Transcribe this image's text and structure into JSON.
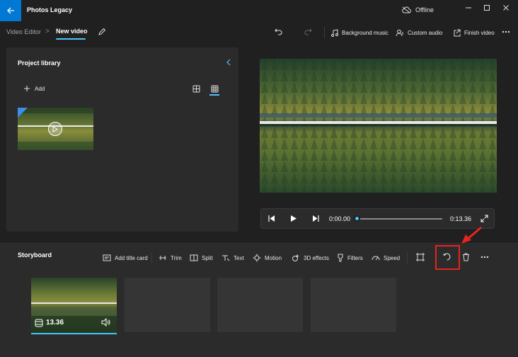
{
  "window": {
    "title": "Photos Legacy",
    "status": "Offline",
    "accent_color": "#0078d4"
  },
  "breadcrumb": {
    "parent": "Video Editor",
    "separator": ">",
    "current": "New video"
  },
  "toolbar": {
    "background_music": "Background music",
    "custom_audio": "Custom audio",
    "finish_video": "Finish video"
  },
  "library": {
    "title": "Project library",
    "add_label": "Add"
  },
  "player": {
    "current_time": "0:00.00",
    "total_time": "0:13.36",
    "progress": 0.0
  },
  "storyboard": {
    "title": "Storyboard",
    "tools": {
      "add_title_card": "Add title card",
      "trim": "Trim",
      "split": "Split",
      "text": "Text",
      "motion": "Motion",
      "effects_3d": "3D effects",
      "filters": "Filters",
      "speed": "Speed"
    },
    "clips": [
      {
        "duration": "13.36"
      }
    ]
  },
  "icons": [
    "back-arrow-icon",
    "cloud-offline-icon",
    "minimize-icon",
    "maximize-icon",
    "close-icon",
    "pencil-icon",
    "undo-icon",
    "redo-icon",
    "music-icon",
    "custom-audio-icon",
    "export-icon",
    "more-icon",
    "chevron-left-icon",
    "plus-icon",
    "list-view-icon",
    "grid-view-icon",
    "play-icon",
    "skip-back-icon",
    "skip-forward-icon",
    "fullscreen-icon",
    "title-card-icon",
    "trim-icon",
    "split-icon",
    "text-icon",
    "motion-icon",
    "3d-effects-icon",
    "filters-icon",
    "speed-icon",
    "resize-icon",
    "rotate-icon",
    "delete-icon",
    "volume-icon"
  ],
  "annotation_color": "#e8231e"
}
